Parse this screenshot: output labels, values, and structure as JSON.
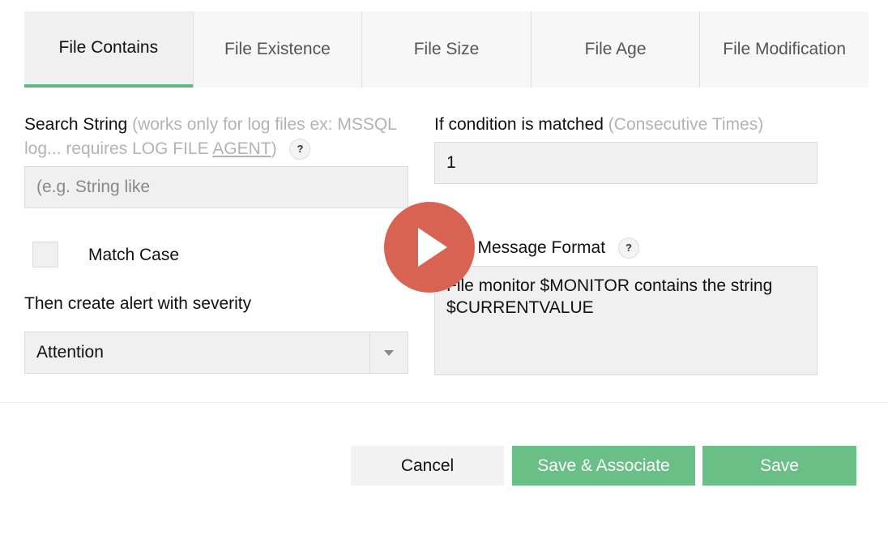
{
  "tabs": [
    {
      "label": "File Contains",
      "active": true
    },
    {
      "label": "File Existence",
      "active": false
    },
    {
      "label": "File Size",
      "active": false
    },
    {
      "label": "File Age",
      "active": false
    },
    {
      "label": "File Modification",
      "active": false
    }
  ],
  "search": {
    "label": "Search String",
    "hint_part1": "(works only for log files ex: MSSQL log... requires LOG FILE ",
    "hint_link": "AGENT",
    "hint_part2": ")",
    "help": "?",
    "placeholder": "(e.g. String like"
  },
  "match_case": {
    "label": "Match Case",
    "checked": false
  },
  "severity": {
    "label": "Then create alert with severity",
    "value": "Attention"
  },
  "condition": {
    "label": "If condition is matched",
    "hint": "(Consecutive Times)",
    "value": "1"
  },
  "message": {
    "label": "n Message Format",
    "help": "?",
    "value": "File monitor $MONITOR contains the string $CURRENTVALUE"
  },
  "buttons": {
    "cancel": "Cancel",
    "save_associate": "Save & Associate",
    "save": "Save"
  },
  "colors": {
    "accent": "#6abf86",
    "play": "#d96353"
  },
  "icons": {
    "play": "play-icon",
    "help": "question-icon",
    "dropdown": "chevron-down-icon"
  }
}
